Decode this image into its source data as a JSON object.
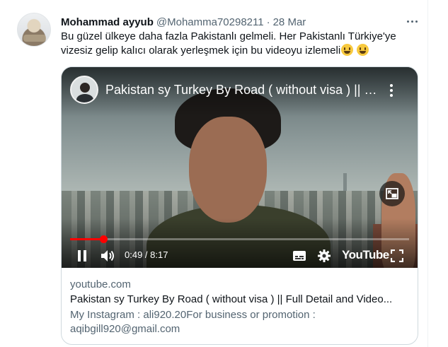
{
  "tweet": {
    "author_name": "Mohammad ayyub",
    "handle": "@Mohamma70298211",
    "separator": "·",
    "date": "28 Mar",
    "text": "Bu güzel ülkeye daha fazla Pakistanlı gelmeli. Her Pakistanlı Türkiye'ye vizesiz gelip kalıcı olarak yerleşmek için bu videoyu izlemeli",
    "emojis": [
      "grinning-face-emoji",
      "grinning-face-emoji"
    ]
  },
  "video": {
    "title": "Pakistan sy Turkey By Road ( without visa ) || F...",
    "current_time": "0:49",
    "duration": "8:17",
    "time_separator": " / ",
    "progress_fraction": 0.0986,
    "logo_text": "YouTube",
    "state": "paused"
  },
  "card": {
    "domain": "youtube.com",
    "title": "Pakistan sy Turkey By Road ( without visa ) || Full Detail and Video...",
    "description": "My Instagram : ali920.20For business or promotion : aqibgill920@gmail.com"
  },
  "colors": {
    "text_primary": "#0f1419",
    "text_secondary": "#536471",
    "border": "#cfd9de",
    "progress": "#ff0000"
  },
  "icons": [
    "more-icon",
    "kebab-icon",
    "miniplayer-icon",
    "pause-icon",
    "volume-icon",
    "captions-icon",
    "settings-icon",
    "fullscreen-icon"
  ]
}
